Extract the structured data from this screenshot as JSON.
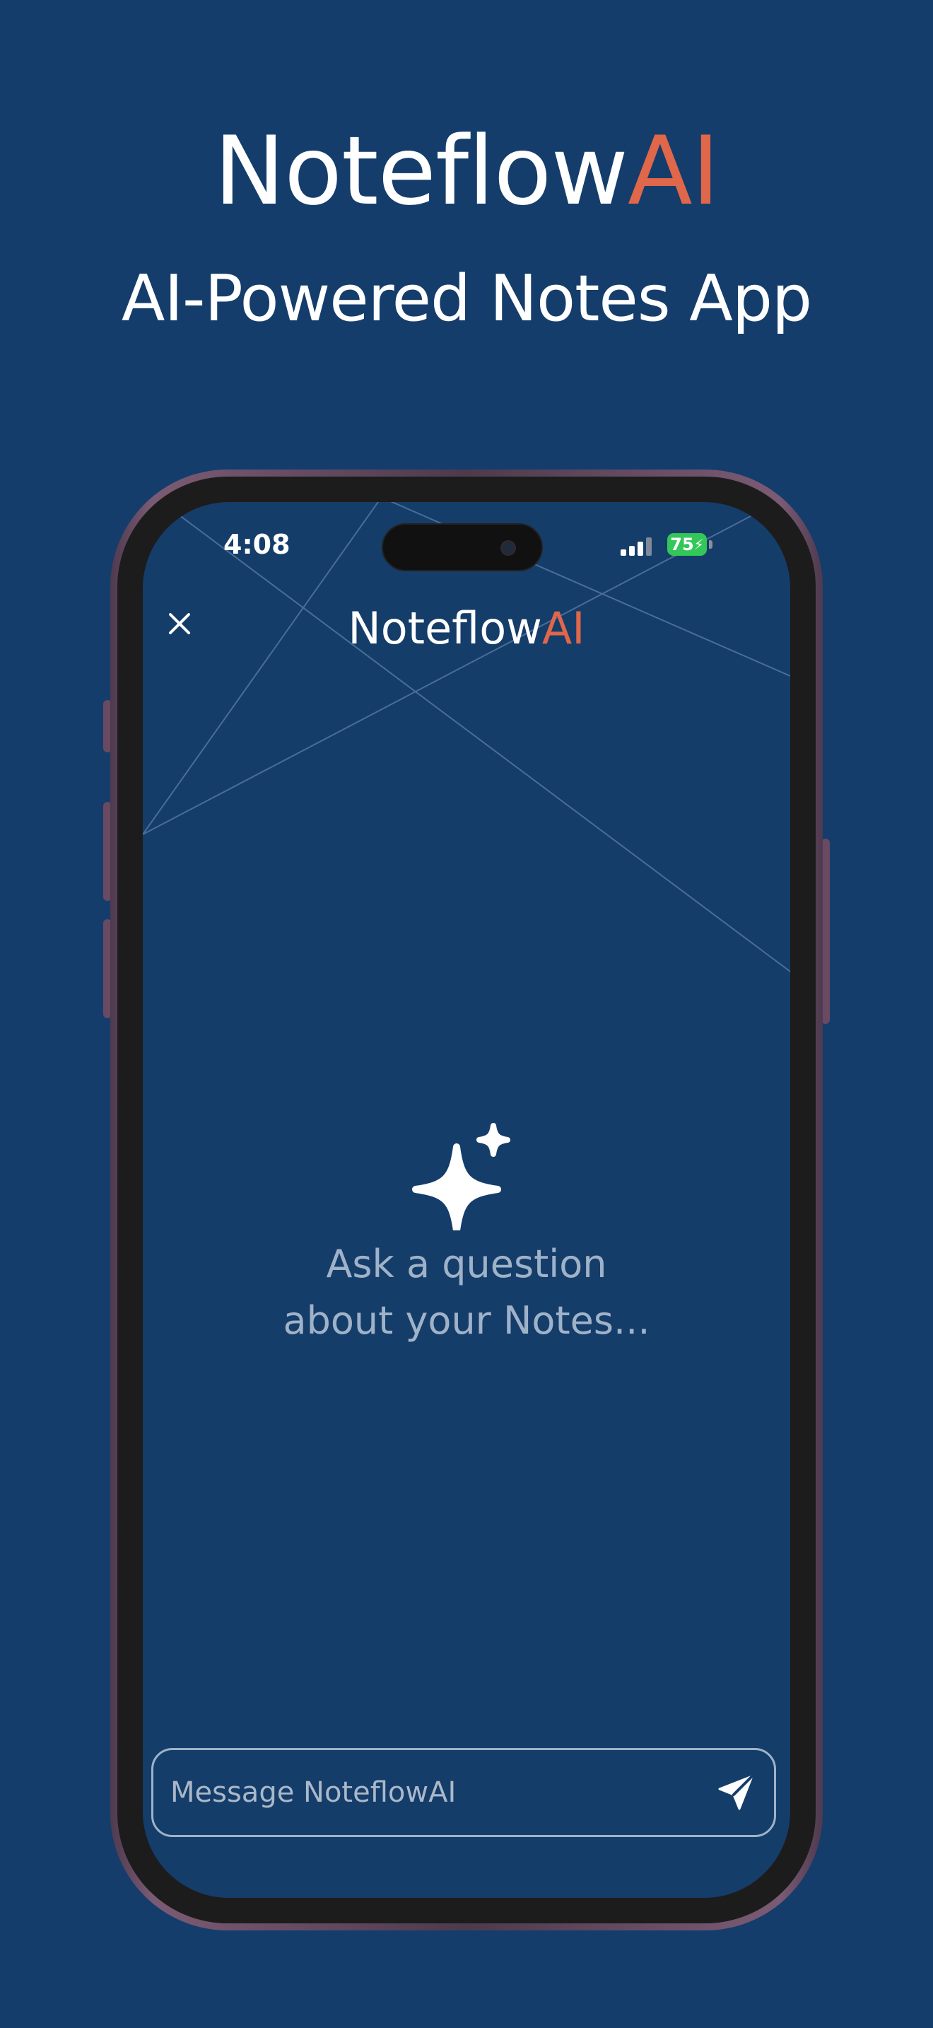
{
  "hero": {
    "title_main": "Noteflow",
    "title_accent": "AI",
    "subtitle": "AI-Powered Notes App"
  },
  "status_bar": {
    "time": "4:08",
    "battery_level": "75"
  },
  "header": {
    "title_main": "Noteflow",
    "title_accent": "AI",
    "close_icon": "close-icon"
  },
  "empty_state": {
    "icon": "sparkle-icon",
    "line1": "Ask a question",
    "line2": "about your Notes..."
  },
  "composer": {
    "placeholder": "Message NoteflowAI",
    "value": "",
    "send_icon": "send-icon"
  },
  "colors": {
    "background": "#143d6b",
    "accent": "#e0674a",
    "muted_text": "#9fb2c8",
    "battery": "#33c759"
  }
}
